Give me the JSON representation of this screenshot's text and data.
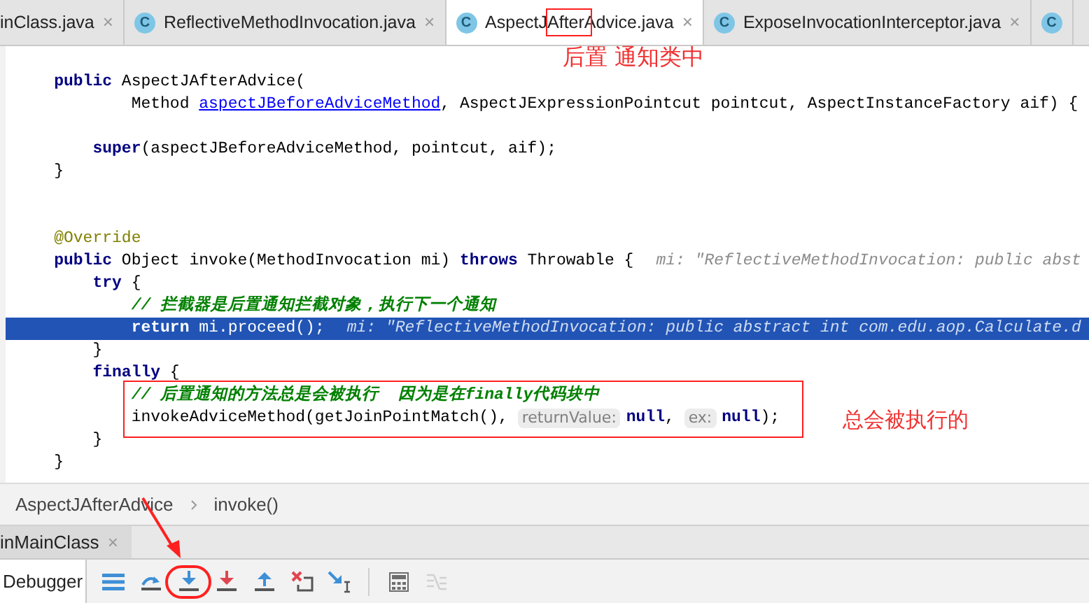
{
  "editor_tabs": [
    {
      "label": "inClass.java",
      "close": "×",
      "selected": false
    },
    {
      "label": "ReflectiveMethodInvocation.java",
      "badge": "C",
      "close": "×",
      "selected": false
    },
    {
      "label": "AspectJAfterAdvice.java",
      "badge": "C",
      "close": "×",
      "selected": true,
      "marked": true
    },
    {
      "label": "ExposeInvocationInterceptor.java",
      "badge": "C",
      "close": "×",
      "selected": false
    },
    {
      "badge": "C",
      "selected": false
    }
  ],
  "tab_annotation": "后置 通知类中",
  "code_lines": [
    {
      "kind": "code",
      "tokens": [
        {
          "kind": "kw",
          "text": "    public"
        },
        {
          "kind": "plain",
          "text": " AspectJAfterAdvice("
        }
      ]
    },
    {
      "kind": "code",
      "tokens": [
        {
          "kind": "plain",
          "text": "            Method "
        },
        {
          "kind": "link",
          "text": "aspectJBeforeAdviceMethod"
        },
        {
          "kind": "plain",
          "text": ", AspectJExpressionPointcut pointcut, AspectInstanceFactory aif) {"
        }
      ]
    },
    {
      "kind": "blank"
    },
    {
      "kind": "code",
      "tokens": [
        {
          "kind": "kw",
          "text": "        super"
        },
        {
          "kind": "plain",
          "text": "(aspectJBeforeAdviceMethod, pointcut, aif);"
        }
      ]
    },
    {
      "kind": "code",
      "tokens": [
        {
          "kind": "plain",
          "text": "    }"
        }
      ]
    },
    {
      "kind": "blank"
    },
    {
      "kind": "blank"
    },
    {
      "kind": "code",
      "tokens": [
        {
          "kind": "annot",
          "text": "    @Override"
        }
      ]
    },
    {
      "kind": "code",
      "tokens": [
        {
          "kind": "kw",
          "text": "    public"
        },
        {
          "kind": "plain",
          "text": " Object invoke(MethodInvocation mi) "
        },
        {
          "kind": "kw",
          "text": "throws"
        },
        {
          "kind": "plain",
          "text": " Throwable {"
        },
        {
          "kind": "hint",
          "text": "mi: \"ReflectiveMethodInvocation: public abst"
        }
      ]
    },
    {
      "kind": "code",
      "tokens": [
        {
          "kind": "kw",
          "text": "        try"
        },
        {
          "kind": "plain",
          "text": " {"
        }
      ]
    },
    {
      "kind": "code",
      "tokens": [
        {
          "kind": "comment",
          "text": "            // 拦截器是后置通知拦截对象，执行下一个通知"
        }
      ]
    },
    {
      "kind": "code",
      "highlighted": true,
      "tokens": [
        {
          "kind": "kw",
          "text": "            return"
        },
        {
          "kind": "plain",
          "text": " mi.proceed();"
        },
        {
          "kind": "hint",
          "text": "mi: \"ReflectiveMethodInvocation: public abstract int com.edu.aop.Calculate.d"
        }
      ]
    },
    {
      "kind": "code",
      "tokens": [
        {
          "kind": "plain",
          "text": "        }"
        }
      ]
    },
    {
      "kind": "code",
      "tokens": [
        {
          "kind": "kw",
          "text": "        finally"
        },
        {
          "kind": "plain",
          "text": " {"
        }
      ]
    },
    {
      "kind": "code",
      "boxed": true,
      "tokens": [
        {
          "kind": "comment",
          "text": "            // 后置通知的方法总是会被执行  因为是在finally代码块中"
        }
      ]
    },
    {
      "kind": "code",
      "boxed": true,
      "note": "总会被执行的",
      "tokens": [
        {
          "kind": "plain",
          "text": "            invokeAdviceMethod(getJoinPointMatch(), "
        },
        {
          "kind": "inlay",
          "text": "returnValue:"
        },
        {
          "kind": "kw",
          "text": "null"
        },
        {
          "kind": "plain",
          "text": ", "
        },
        {
          "kind": "inlay",
          "text": "ex:"
        },
        {
          "kind": "kw",
          "text": "null"
        },
        {
          "kind": "plain",
          "text": ");"
        }
      ]
    },
    {
      "kind": "code",
      "tokens": [
        {
          "kind": "plain",
          "text": "        }"
        }
      ]
    },
    {
      "kind": "code",
      "tokens": [
        {
          "kind": "plain",
          "text": "    }"
        }
      ]
    }
  ],
  "breadcrumb": [
    "AspectJAfterAdvice",
    "invoke()"
  ],
  "debug_tab": {
    "label": "inMainClass",
    "close": "×"
  },
  "debugger_tab": {
    "label": "Debugger",
    "selected": true
  },
  "toolbar_buttons": [
    {
      "kind": "menu",
      "disabled": false
    },
    {
      "kind": "step-over",
      "disabled": false
    },
    {
      "kind": "step-into",
      "disabled": false,
      "circled": true
    },
    {
      "kind": "force-step-into",
      "disabled": false
    },
    {
      "kind": "step-out",
      "disabled": false
    },
    {
      "kind": "drop-frame",
      "disabled": false
    },
    {
      "kind": "run-to-cursor",
      "disabled": false
    },
    {
      "kind": "divider"
    },
    {
      "kind": "evaluate",
      "disabled": false
    },
    {
      "kind": "trace",
      "disabled": true
    }
  ]
}
